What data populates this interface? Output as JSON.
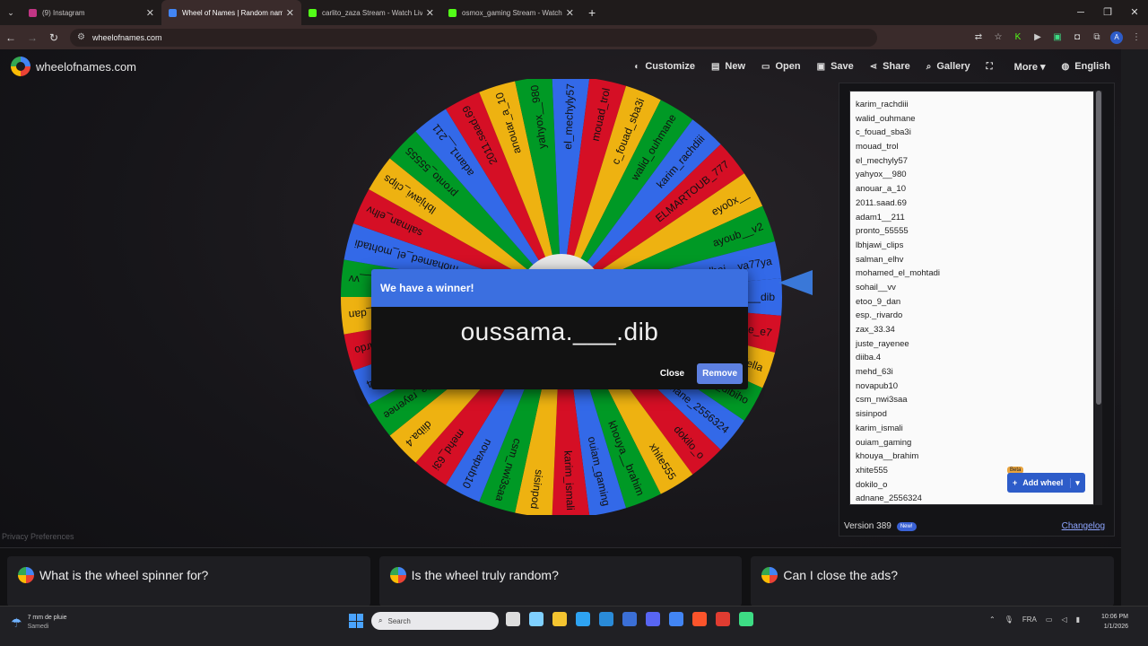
{
  "browser": {
    "tabs": [
      {
        "title": "(9) Instagram",
        "color": "#c13584"
      },
      {
        "title": "Wheel of Names | Random nam",
        "color": "#4285f4"
      },
      {
        "title": "carlito_zaza Stream - Watch Liv",
        "color": "#53fc18"
      },
      {
        "title": "osmox_gaming Stream - Watch",
        "color": "#53fc18"
      }
    ],
    "url": "wheelofnames.com"
  },
  "site": {
    "name": "wheelofnames.com",
    "menu": [
      {
        "label": "Customize",
        "icon": "palette-icon",
        "glyph": "◐"
      },
      {
        "label": "New",
        "icon": "file-icon",
        "glyph": "▤"
      },
      {
        "label": "Open",
        "icon": "folder-icon",
        "glyph": "▭"
      },
      {
        "label": "Save",
        "icon": "save-icon",
        "glyph": "▣"
      },
      {
        "label": "Share",
        "icon": "share-icon",
        "glyph": "⋖"
      },
      {
        "label": "Gallery",
        "icon": "search-icon",
        "glyph": "⌕"
      },
      {
        "label": "",
        "icon": "fullscreen-icon",
        "glyph": "⛶"
      },
      {
        "label": "More ▾",
        "icon": "more-icon",
        "glyph": ""
      },
      {
        "label": "English",
        "icon": "globe-icon",
        "glyph": "◍"
      }
    ]
  },
  "wheel": {
    "colors": [
      "#3369e8",
      "#d50f25",
      "#eeb211",
      "#009925"
    ],
    "segments": [
      "oussama.___dib",
      "amine_e7",
      "hicham_fella",
      "yassine_dibiho",
      "adnane_2556324",
      "dokilo_o",
      "xhite555",
      "khouya__brahim",
      "ouiam_gaming",
      "karim_ismali",
      "sisinpod",
      "csm_nwi3saa",
      "novapub10",
      "mehd_63i",
      "diiba.4",
      "juste_rayenee",
      "zax_33.34",
      "esp._rivardo",
      "etoo_9_dan",
      "sohail__vv",
      "mohamed_el_mohtadi",
      "salman_elhv",
      "lbhjawi_clips",
      "pronto_55555",
      "adam1__211",
      "2011.saad.69",
      "anouar_a_10",
      "yahyox__980",
      "el_mechyly57",
      "mouad_trol",
      "c_fouad_sba3i",
      "walid_ouhmane",
      "karim_rachdiii",
      "ELMARTOUB_777",
      "eyo0x__",
      "ayoub__v2",
      "lhaj__ya77ya"
    ]
  },
  "dialog": {
    "title": "We have a winner!",
    "winner": "oussama.___.dib",
    "close": "Close",
    "remove": "Remove"
  },
  "entries": [
    "karim_rachdiii",
    "walid_ouhmane",
    "c_fouad_sba3i",
    "mouad_trol",
    "el_mechyly57",
    "yahyox__980",
    "anouar_a_10",
    "2011.saad.69",
    "adam1__211",
    "pronto_55555",
    "lbhjawi_clips",
    "salman_elhv",
    "mohamed_el_mohtadi",
    "sohail__vv",
    "etoo_9_dan",
    "esp._rivardo",
    "zax_33.34",
    "juste_rayenee",
    "diiba.4",
    "mehd_63i",
    "novapub10",
    "csm_nwi3saa",
    "sisinpod",
    "karim_ismali",
    "ouiam_gaming",
    "khouya__brahim",
    "xhite555",
    "dokilo_o",
    "adnane_2556324"
  ],
  "panel": {
    "add_wheel": "Add wheel",
    "beta": "Beta",
    "version": "Version 389",
    "new_badge": "New!",
    "changelog": "Changelog"
  },
  "privacy": "Privacy Preferences",
  "faq": [
    "What is the wheel spinner for?",
    "Is the wheel truly random?",
    "Can I close the ads?"
  ],
  "taskbar": {
    "weather_line1": "7 mm de pluie",
    "weather_line2": "Samedi",
    "search_placeholder": "Search",
    "lang": "FRA",
    "time": "10:06 PM",
    "date": "1/1/2026",
    "apps": [
      "#ddd",
      "#7fd0ff",
      "#f4c430",
      "#2ea3f2",
      "#2a8bd8",
      "#3b6fd6",
      "#5865f2",
      "#4285f4",
      "#fb542b",
      "#e03c31",
      "#3ddc84"
    ]
  }
}
